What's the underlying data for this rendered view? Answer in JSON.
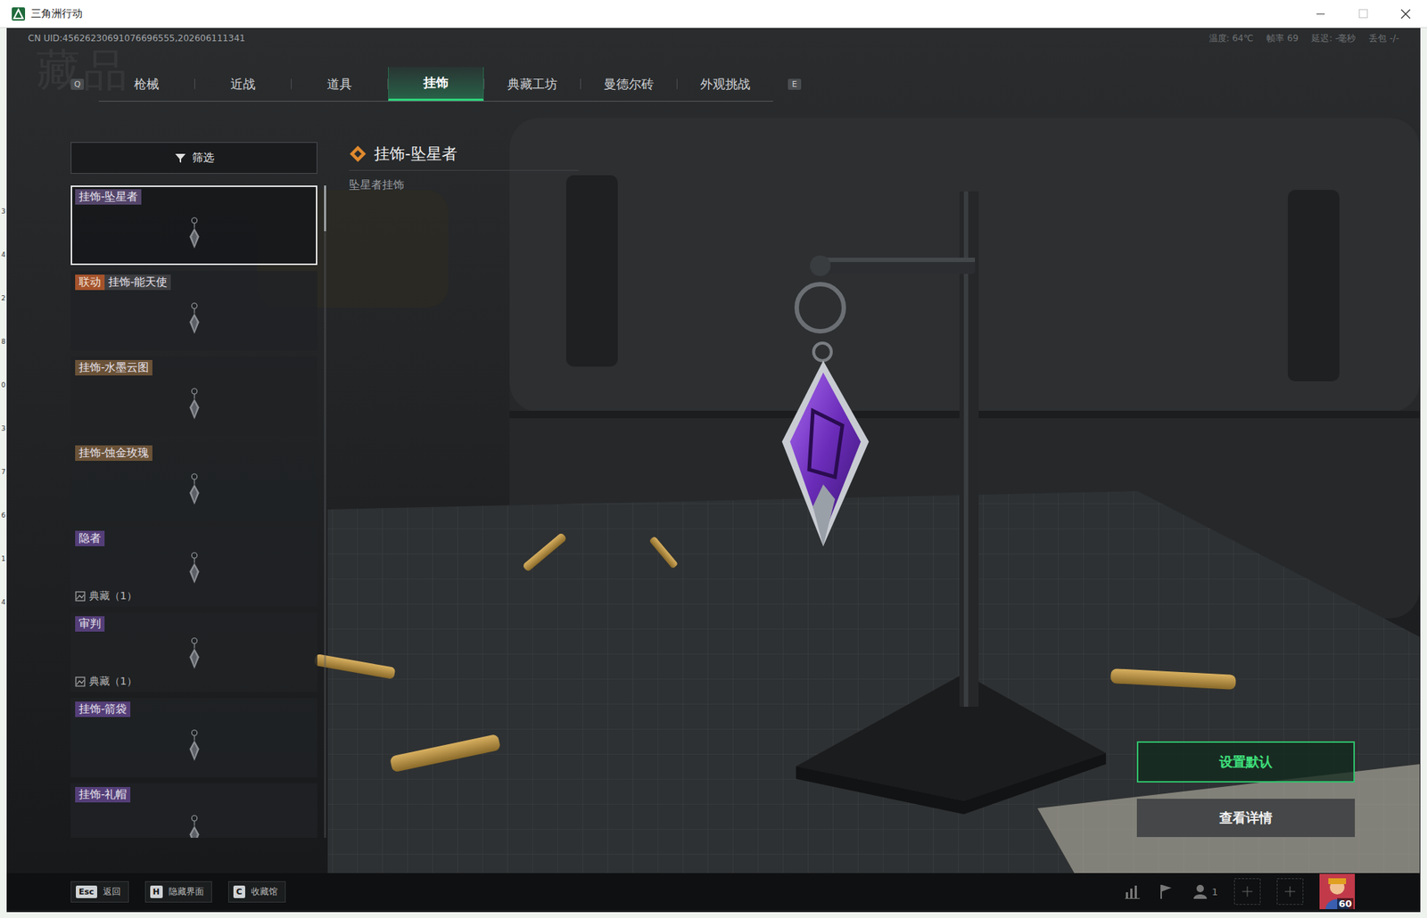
{
  "window": {
    "title": "三角洲行动"
  },
  "background_app": {
    "row_numbers": [
      "3",
      "4",
      "2",
      "8",
      "0",
      "3",
      "7",
      "6",
      "1",
      "4"
    ]
  },
  "session": {
    "uid": "CN UID:45626230691076696555,202606111341"
  },
  "stats": [
    {
      "label": "温度:",
      "value": "64℃"
    },
    {
      "label": "帧率",
      "value": "69"
    },
    {
      "label": "延迟:",
      "value": "-毫秒"
    },
    {
      "label": "丢包",
      "value": "-/-"
    }
  ],
  "page_title": "藏品",
  "tab_keys": {
    "prev": "Q",
    "next": "E"
  },
  "tabs": [
    {
      "label": "枪械",
      "selected": false
    },
    {
      "label": "近战",
      "selected": false
    },
    {
      "label": "道具",
      "selected": false
    },
    {
      "label": "挂饰",
      "selected": true
    },
    {
      "label": "典藏工坊",
      "selected": false
    },
    {
      "label": "曼德尔砖",
      "selected": false
    },
    {
      "label": "外观挑战",
      "selected": false
    }
  ],
  "filter": {
    "label": "筛选"
  },
  "items": [
    {
      "label": "挂饰-坠星者",
      "color": "#54456a",
      "selected": true
    },
    {
      "label": "挂饰-能天使",
      "tag": "联动",
      "color": "#3d3d40",
      "selected": false
    },
    {
      "label": "挂饰-水墨云图",
      "color": "#6a5238",
      "selected": false
    },
    {
      "label": "挂饰-蚀金玫瑰",
      "color": "#6a5238",
      "selected": false
    },
    {
      "label": "隐者",
      "collection": "典藏（1）",
      "color": "#543e78",
      "selected": false
    },
    {
      "label": "审判",
      "collection": "典藏（1）",
      "color": "#543e78",
      "selected": false
    },
    {
      "label": "挂饰-箭袋",
      "color": "#543e78",
      "selected": false
    },
    {
      "label": "挂饰-礼帽",
      "color": "#543e78",
      "selected": false
    }
  ],
  "list_scroll": {
    "level": 0.07
  },
  "detail": {
    "title": "挂饰-坠星者",
    "subtitle": "坠星者挂饰"
  },
  "actions": [
    {
      "label": "设置默认",
      "primary": true
    },
    {
      "label": "查看详情",
      "primary": false
    }
  ],
  "hotkeys": [
    {
      "key": "Esc",
      "label": "返回"
    },
    {
      "key": "H",
      "label": "隐藏界面"
    },
    {
      "key": "C",
      "label": "收藏馆"
    }
  ],
  "footer": {
    "party_count": "1",
    "level": "60"
  }
}
